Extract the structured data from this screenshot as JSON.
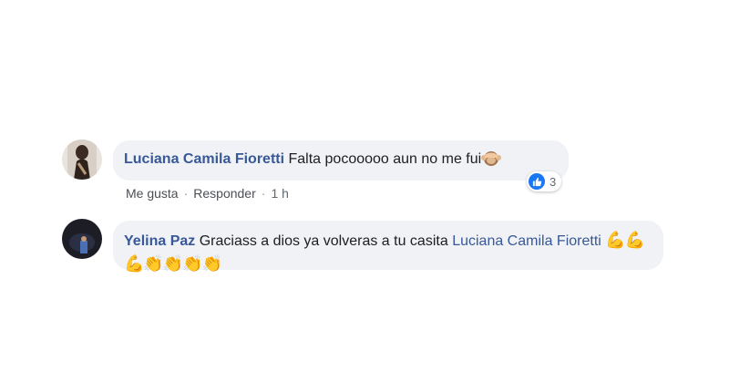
{
  "comments": [
    {
      "author": "Luciana Camila Fioretti",
      "text": "Falta pocooooo aun no me fui",
      "emoji": "see-no-evil-monkey",
      "actions": {
        "like": "Me gusta",
        "reply": "Responder",
        "dot": "·",
        "time": "1 h"
      },
      "reactions": {
        "count": "3",
        "type": "like"
      }
    },
    {
      "author": "Yelina Paz",
      "text": "Graciass a dios ya volveras a tu casita",
      "mention": "Luciana Camila Fioretti",
      "emojis": [
        "💪",
        "💪",
        "💪",
        "👏",
        "👏",
        "👏",
        "👏"
      ]
    }
  ],
  "colors": {
    "name_link": "#385898",
    "bubble_bg": "#f0f2f5",
    "like_blue": "#1877f2"
  }
}
